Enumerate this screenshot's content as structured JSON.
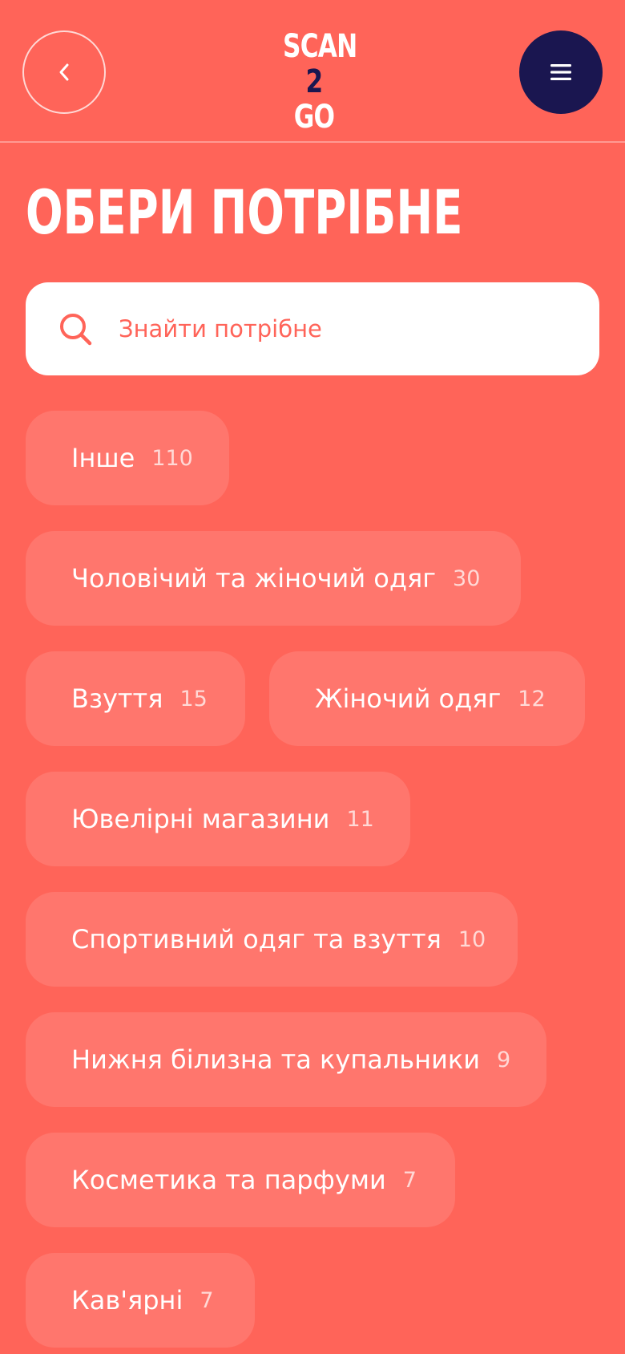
{
  "header": {
    "back_label": "‹",
    "logo": {
      "line1": "SCAN",
      "num": "2",
      "go": "GO"
    }
  },
  "page": {
    "title": "ОБЕРИ ПОТРІБНЕ"
  },
  "search": {
    "placeholder": "Знайти потрібне",
    "value": ""
  },
  "categories": [
    {
      "label": "Інше",
      "count": "110"
    },
    {
      "label": "Чоловічий та жіночий одяг",
      "count": "30"
    },
    {
      "label": "Взуття",
      "count": "15"
    },
    {
      "label": "Жіночий одяг",
      "count": "12"
    },
    {
      "label": "Ювелірні магазини",
      "count": "11"
    },
    {
      "label": "Спортивний одяг та взуття",
      "count": "10"
    },
    {
      "label": "Нижня білизна та купальники",
      "count": "9"
    },
    {
      "label": "Косметика та парфуми",
      "count": "7"
    },
    {
      "label": "Кав'ярні",
      "count": "7"
    }
  ],
  "colors": {
    "background": "#FF6459",
    "navy": "#1A1650",
    "chip": "rgba(255,255,255,0.12)"
  },
  "icons": {
    "back": "chevron-left-icon",
    "menu": "hamburger-menu-icon",
    "search": "search-icon"
  }
}
